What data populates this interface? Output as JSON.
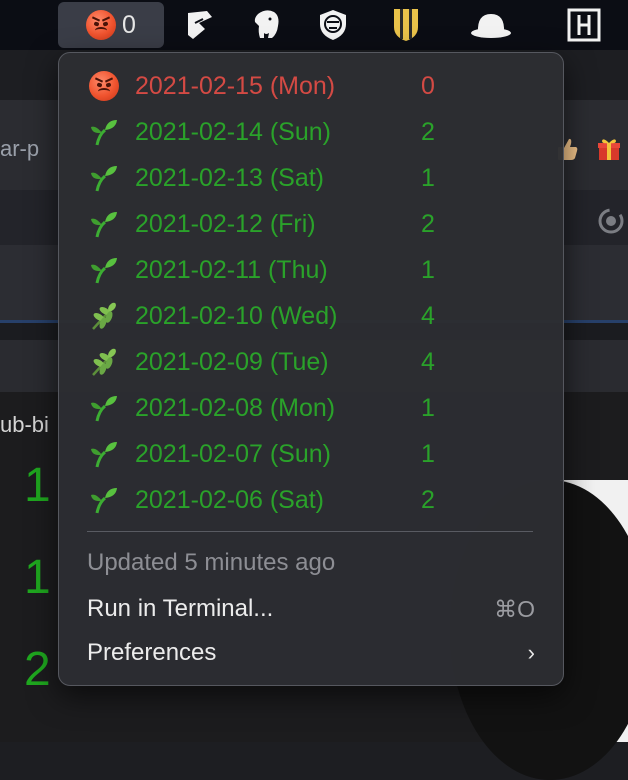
{
  "menubar": {
    "active_item": {
      "icon": "angry-face-icon",
      "count": "0"
    },
    "icons": [
      "pen-nib-icon",
      "elephant-icon",
      "shield-cat-icon",
      "striped-shield-icon",
      "bowler-hat-icon",
      "grid-box-icon"
    ]
  },
  "background": {
    "tab_fragment": "ar-p",
    "side_text": "ub-bi",
    "numbers": [
      "1",
      "1",
      "2"
    ],
    "icons": [
      "thumbs-up-icon",
      "gift-icon",
      "refresh-icon"
    ]
  },
  "dropdown": {
    "days": [
      {
        "icon": "angry-face-icon",
        "date": "2021-02-15 (Mon)",
        "count": "0",
        "state": "today"
      },
      {
        "icon": "seedling-icon",
        "date": "2021-02-14 (Sun)",
        "count": "2",
        "state": "done"
      },
      {
        "icon": "seedling-icon",
        "date": "2021-02-13 (Sat)",
        "count": "1",
        "state": "done"
      },
      {
        "icon": "seedling-icon",
        "date": "2021-02-12 (Fri)",
        "count": "2",
        "state": "done"
      },
      {
        "icon": "seedling-icon",
        "date": "2021-02-11 (Thu)",
        "count": "1",
        "state": "done"
      },
      {
        "icon": "herb-icon",
        "date": "2021-02-10 (Wed)",
        "count": "4",
        "state": "done"
      },
      {
        "icon": "herb-icon",
        "date": "2021-02-09 (Tue)",
        "count": "4",
        "state": "done"
      },
      {
        "icon": "seedling-icon",
        "date": "2021-02-08 (Mon)",
        "count": "1",
        "state": "done"
      },
      {
        "icon": "seedling-icon",
        "date": "2021-02-07 (Sun)",
        "count": "1",
        "state": "done"
      },
      {
        "icon": "seedling-icon",
        "date": "2021-02-06 (Sat)",
        "count": "2",
        "state": "done"
      }
    ],
    "status": "Updated 5 minutes ago",
    "run_label": "Run in Terminal...",
    "run_shortcut": "⌘O",
    "prefs_label": "Preferences",
    "prefs_chevron": "›"
  },
  "colors": {
    "today": "#d44a44",
    "done": "#2aa22a",
    "menubar": "#0b0d14",
    "panel": "#2c2d32"
  }
}
